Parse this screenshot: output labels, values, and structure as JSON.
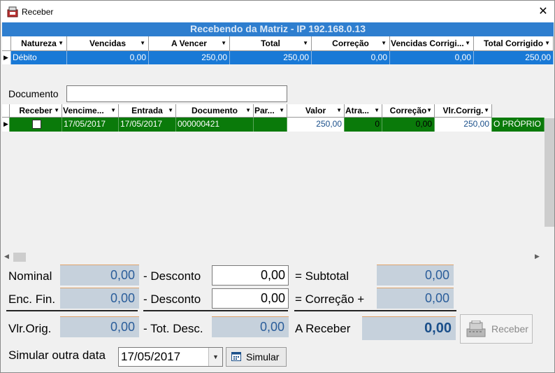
{
  "window": {
    "title": "Receber",
    "close_glyph": "✕"
  },
  "top_grid": {
    "banner": "Recebendo da Matriz - IP 192.168.0.13",
    "columns": [
      "Natureza",
      "Vencidas",
      "A Vencer",
      "Total",
      "Correção",
      "Vencidas Corrigi...",
      "Total Corrigido"
    ],
    "row": [
      "Débito",
      "0,00",
      "250,00",
      "250,00",
      "0,00",
      "0,00",
      "250,00"
    ]
  },
  "documento": {
    "label": "Documento",
    "value": ""
  },
  "grid2": {
    "columns": [
      "Receber",
      "Vencime...",
      "Entrada",
      "Documento",
      "Par...",
      "Valor",
      "Atra...",
      "Correção",
      "Vlr.Corrig."
    ],
    "row": {
      "vencimento": "17/05/2017",
      "entrada": "17/05/2017",
      "documento": "000000421",
      "parcela": "",
      "valor": "250,00",
      "atraso": "0",
      "correcao": "0,00",
      "vlr_corrig": "250,00",
      "extra": "O PRÓPRIO"
    }
  },
  "form": {
    "nominal_label": "Nominal",
    "nominal_value": "0,00",
    "desconto_label": "- Desconto",
    "desconto1_value": "0,00",
    "desconto2_value": "0,00",
    "subtotal_label": "= Subtotal",
    "subtotal_value": "0,00",
    "enc_fin_label": "Enc. Fin.",
    "enc_fin_value": "0,00",
    "correcao_label": "= Correção  +",
    "correcao_value": "0,00",
    "vlr_orig_label": "Vlr.Orig.",
    "vlr_orig_value": "0,00",
    "tot_desc_label": "- Tot. Desc.",
    "tot_desc_value": "0,00",
    "a_receber_label": "A Receber",
    "a_receber_value": "0,00",
    "receber_button": "Receber",
    "simular_label": "Simular outra data",
    "simular_date": "17/05/2017",
    "simular_button": "Simular"
  },
  "colors": {
    "banner": "#2e7ecf",
    "selected_row": "#1979d6",
    "green_row": "#0a7a0a",
    "value_box": "#c6d1dc"
  }
}
